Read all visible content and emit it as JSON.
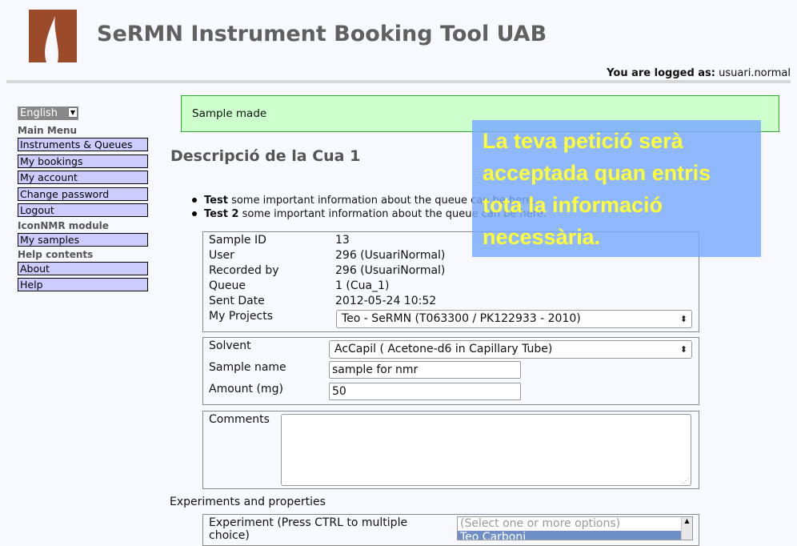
{
  "header": {
    "app_title": "SeRMN Instrument Booking Tool UAB",
    "logged_label": "You are logged as:",
    "username": "usuari.normal",
    "logo_icon": "uab-curtain-logo",
    "logo_color": "#9b4a2a"
  },
  "language_select": {
    "value": "English"
  },
  "sidebar": {
    "main_menu_heading": "Main Menu",
    "main_menu": [
      "Instruments & Queues",
      "My bookings",
      "My account",
      "Change password",
      "Logout"
    ],
    "iconnmr_heading": "IconNMR module",
    "iconnmr_menu": [
      "My samples"
    ],
    "help_heading": "Help contents",
    "help_menu": [
      "About",
      "Help"
    ]
  },
  "alert": {
    "message": "Sample made"
  },
  "overlay_note": {
    "lines": [
      "La teva petició serà",
      "acceptada quan entris",
      "tota la informació",
      "necessària."
    ]
  },
  "queue": {
    "title": "Descripció de la Cua 1",
    "info": [
      {
        "label": "Test",
        "text": "some important information about the queue can be here."
      },
      {
        "label": "Test 2",
        "text": "some important information about the queue can be here."
      }
    ]
  },
  "sample": {
    "fields": [
      {
        "label": "Sample ID",
        "value": "13"
      },
      {
        "label": "User",
        "value": "296 (UsuariNormal)"
      },
      {
        "label": "Recorded by",
        "value": "296 (UsuariNormal)"
      },
      {
        "label": "Queue",
        "value": "1 (Cua_1)"
      },
      {
        "label": "Sent Date",
        "value": "2012-05-24 10:52"
      }
    ],
    "projects_label": "My Projects",
    "projects_value": "Teo - SeRMN (T063300 / PK122933 - 2010)"
  },
  "details": {
    "solvent_label": "Solvent",
    "solvent_value": "AcCapil ( Acetone-d6 in Capillary Tube)",
    "name_label": "Sample name",
    "name_value": "sample for nmr",
    "amount_label": "Amount (mg)",
    "amount_value": "50"
  },
  "comments": {
    "label": "Comments",
    "value": ""
  },
  "experiments": {
    "heading": "Experiments and properties",
    "label_line1": "Experiment (Press CTRL to multiple",
    "label_line2": "choice)",
    "placeholder": "(Select one or more options)",
    "visible_option": "Teo Carboni"
  }
}
